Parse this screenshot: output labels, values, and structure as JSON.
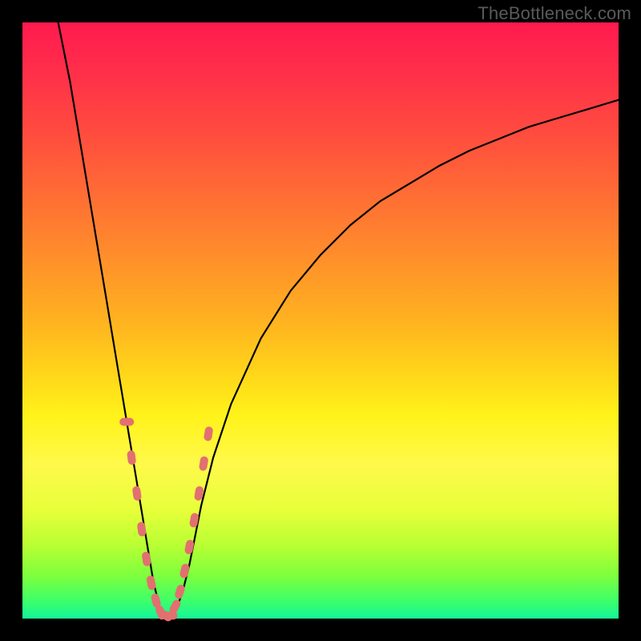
{
  "watermark": "TheBottleneck.com",
  "colors": {
    "frame": "#000000",
    "curve": "#000000",
    "marker": "#e27070",
    "gradient_stops": [
      "#ff1a4f",
      "#ff2e4a",
      "#ff4a3f",
      "#ff6a35",
      "#ff8a2c",
      "#ffb220",
      "#ffd21a",
      "#fff31a",
      "#fff94a",
      "#e6ff3a",
      "#b6ff33",
      "#7bff3f",
      "#3dff6a",
      "#13f59a"
    ]
  },
  "chart_data": {
    "type": "line",
    "title": "",
    "xlabel": "",
    "ylabel": "",
    "xlim": [
      0,
      100
    ],
    "ylim": [
      0,
      100
    ],
    "grid": false,
    "description": "V-shaped bottleneck curve; y represents bottleneck percentage (100=severe red, 0=balanced green). Minimum near x≈22.",
    "series": [
      {
        "name": "bottleneck-curve",
        "x": [
          6,
          8,
          10,
          12,
          14,
          16,
          17,
          18,
          19,
          20,
          21,
          22,
          23,
          24,
          25,
          26,
          27,
          28,
          29,
          30,
          32,
          35,
          40,
          45,
          50,
          55,
          60,
          65,
          70,
          75,
          80,
          85,
          90,
          95,
          100
        ],
        "y": [
          100,
          90,
          78,
          66,
          54,
          42,
          36,
          30,
          24,
          18,
          12,
          6,
          2,
          0.5,
          0.5,
          2,
          5,
          9,
          14,
          19,
          27,
          36,
          47,
          55,
          61,
          66,
          70,
          73,
          76,
          78.5,
          80.5,
          82.5,
          84,
          85.5,
          87
        ]
      }
    ],
    "markers": {
      "name": "highlighted-points",
      "shape": "rounded-capsule",
      "x": [
        17.5,
        18.3,
        19.2,
        20.0,
        20.8,
        21.6,
        22.4,
        23.2,
        24.0,
        24.8,
        25.6,
        26.4,
        27.2,
        28.0,
        28.8,
        29.6,
        30.4,
        31.2
      ],
      "y": [
        33,
        27,
        21,
        15,
        10,
        6,
        3,
        1,
        0.5,
        0.5,
        2,
        4.5,
        8,
        12,
        16.5,
        21,
        26,
        31
      ]
    }
  }
}
